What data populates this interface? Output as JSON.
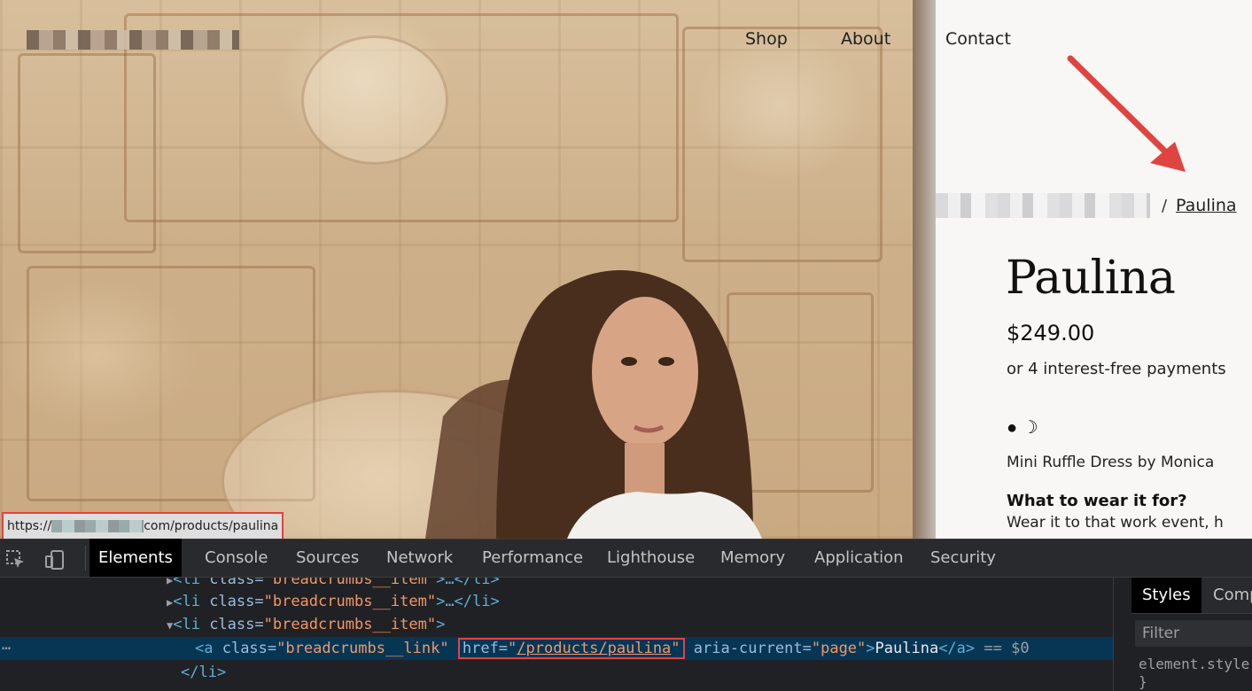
{
  "site": {
    "nav": [
      "Shop",
      "About",
      "Contact"
    ],
    "breadcrumb": {
      "separator": "/",
      "current": "Paulina"
    },
    "product": {
      "title": "Paulina",
      "price": "$249.00",
      "payment_note": "or 4 interest-free payments",
      "icons": "● ☽",
      "description": "Mini Ruffle Dress by Monica",
      "subheading": "What to wear it for?",
      "wear_text": "Wear it to that work event, h"
    },
    "status_url": {
      "prefix": "https://",
      "suffix": "com/products/paulina"
    },
    "annotation_color": "#e0443e"
  },
  "devtools": {
    "tabs": [
      "Elements",
      "Console",
      "Sources",
      "Network",
      "Performance",
      "Lighthouse",
      "Memory",
      "Application",
      "Security"
    ],
    "active_tab": "Elements",
    "dom_lines": {
      "l1": {
        "tag_open": "<li ",
        "attr": "class=",
        "val": "\"breadcrumbs__item\"",
        "rest": ">…</li>"
      },
      "l2": {
        "tag_open": "<li ",
        "attr": "class=",
        "val": "\"breadcrumbs__item\"",
        "rest": ">…</li>"
      },
      "l3": {
        "tag_open": "<li ",
        "attr": "class=",
        "val": "\"breadcrumbs__item\"",
        "rest": ">"
      },
      "l4": {
        "dots": "⋯",
        "tag_open": "<a ",
        "attr1": "class=",
        "val1": "\"breadcrumbs__link\"",
        "attr2": "href=",
        "q_open": "\"",
        "link": "/products/paulina",
        "q_close": "\"",
        "attr3": "aria-current=",
        "val3": "\"page\"",
        "close_gt": ">",
        "text": "Paulina",
        "end_tag": "</a>",
        "marker": "== $0"
      },
      "l5": {
        "tag": "</li>"
      }
    },
    "styles_pane": {
      "tabs": [
        "Styles",
        "Comp"
      ],
      "filter_placeholder": "Filter",
      "rule": "element.style",
      "brace": "}"
    }
  }
}
